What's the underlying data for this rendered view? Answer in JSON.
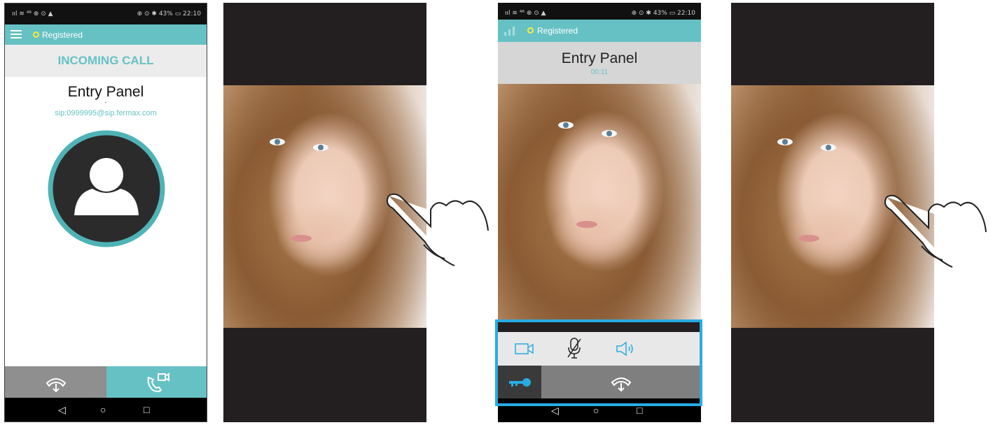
{
  "status_bar": {
    "left": "ııl ≋ ⁴⁶ ⊕ ⊙ ▲",
    "right": "⊕ ⊙ ✱ 43% ▭ 22:10"
  },
  "registration": {
    "label": "Registered",
    "dot_color": "#ffea3a"
  },
  "incoming": {
    "title": "INCOMING CALL",
    "caller": "Entry Panel",
    "separator": "-",
    "sip": "sip:0999995@sip.fermax.com"
  },
  "active_call": {
    "caller": "Entry Panel",
    "timer": "00:11"
  },
  "colors": {
    "teal": "#66c1c4",
    "accent_frame": "#29abe2",
    "dark": "#231f20",
    "grey_panel": "#7f7f7f"
  },
  "icons": {
    "menu": "hamburger-icon",
    "avatar": "person-icon",
    "hangup": "hangup-icon",
    "video_answer": "video-call-icon",
    "camera": "video-camera-icon",
    "mic_off": "microphone-muted-icon",
    "speaker": "speaker-icon",
    "key": "door-key-icon"
  }
}
